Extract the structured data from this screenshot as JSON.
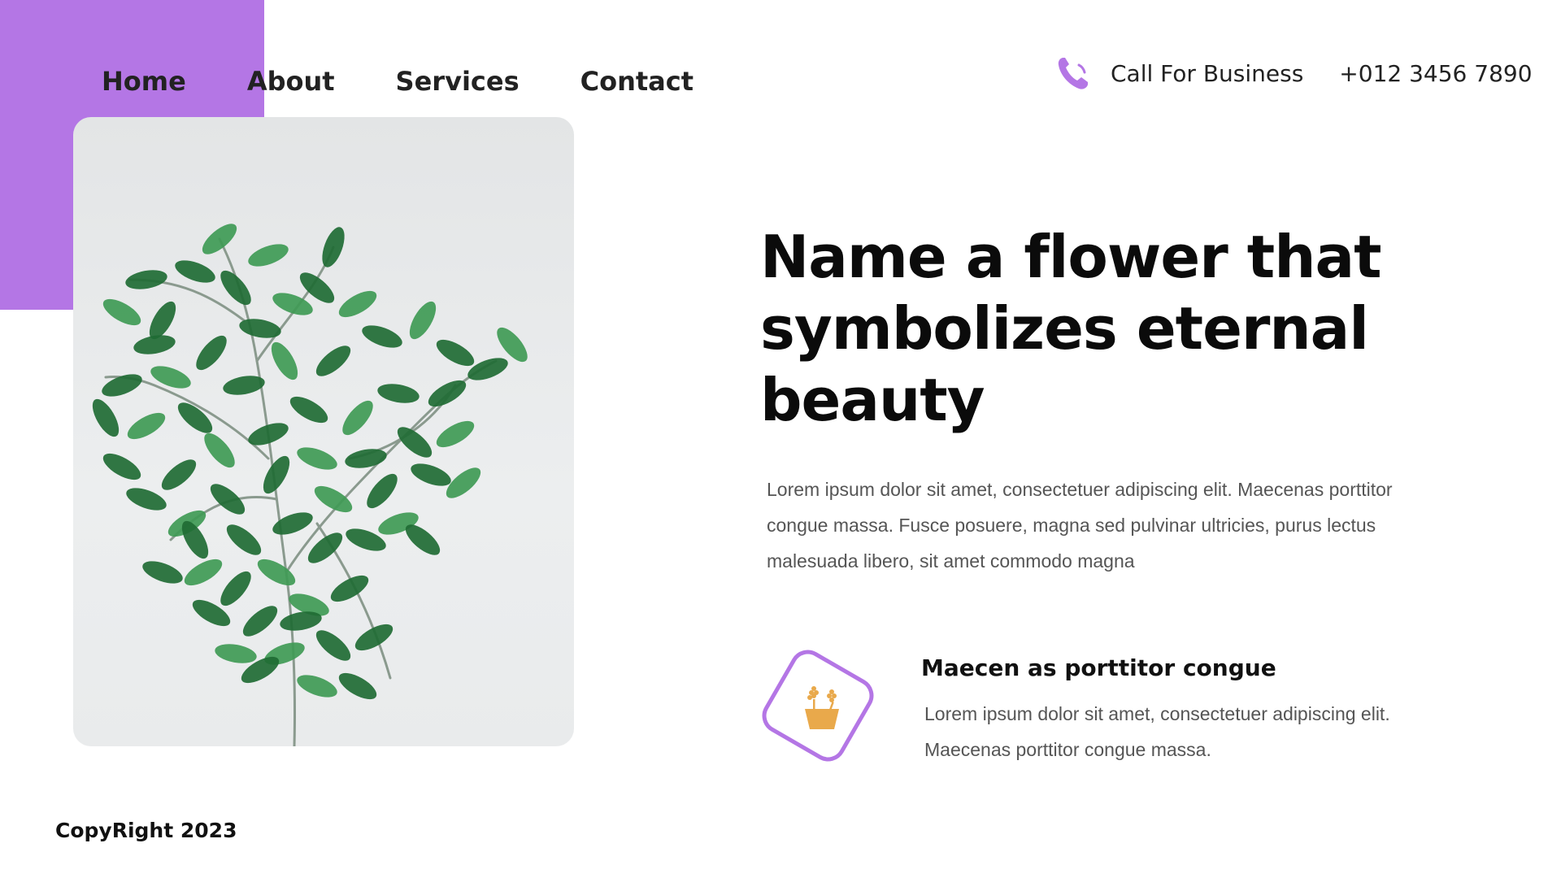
{
  "colors": {
    "accent": "#b476e5",
    "icon_fill": "#e9a94b",
    "leaf_dark": "#1f6b34",
    "leaf_light": "#3f9a55"
  },
  "nav": {
    "items": [
      {
        "label": "Home"
      },
      {
        "label": "About"
      },
      {
        "label": "Services"
      },
      {
        "label": "Contact"
      }
    ]
  },
  "contact": {
    "icon": "phone-icon",
    "label": "Call For Business",
    "phone": "+012 3456 7890"
  },
  "hero": {
    "image_icon": "plant-photo",
    "headline": "Name a flower that symbolizes eternal beauty",
    "body": "Lorem ipsum dolor sit amet, consectetuer adipiscing elit. Maecenas porttitor congue massa. Fusce posuere, magna sed pulvinar ultricies, purus lectus malesuada libero, sit amet commodo magna"
  },
  "feature": {
    "icon": "flower-pot-icon",
    "title": "Maecen as porttitor congue",
    "text": "Lorem ipsum dolor sit amet, consectetuer adipiscing elit. Maecenas porttitor congue massa."
  },
  "footer": {
    "copyright": "CopyRight 2023"
  }
}
